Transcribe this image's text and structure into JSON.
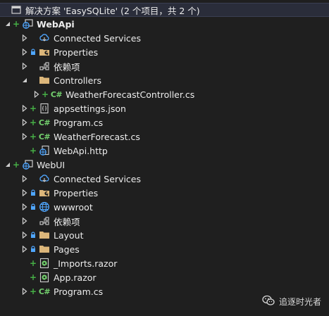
{
  "solution": {
    "title": "解决方案 'EasySQLite' (2 个项目，共 2 个)"
  },
  "webapi": {
    "name": "WebApi",
    "connected_services": "Connected Services",
    "properties": "Properties",
    "dependencies": "依赖项",
    "controllers": "Controllers",
    "controller_file": "WeatherForecastController.cs",
    "appsettings": "appsettings.json",
    "program": "Program.cs",
    "weather": "WeatherForecast.cs",
    "http": "WebApi.http"
  },
  "webui": {
    "name": "WebUI",
    "connected_services": "Connected Services",
    "properties": "Properties",
    "wwwroot": "wwwroot",
    "dependencies": "依赖项",
    "layout": "Layout",
    "pages": "Pages",
    "imports": "_Imports.razor",
    "app": "App.razor",
    "program": "Program.cs"
  },
  "icons": {
    "csharp": "C#",
    "accent_folder": "#dcb67a",
    "accent_plus": "#46b046",
    "accent_lock": "#4fa6ff"
  },
  "watermark": {
    "text": "追逐时光者"
  }
}
